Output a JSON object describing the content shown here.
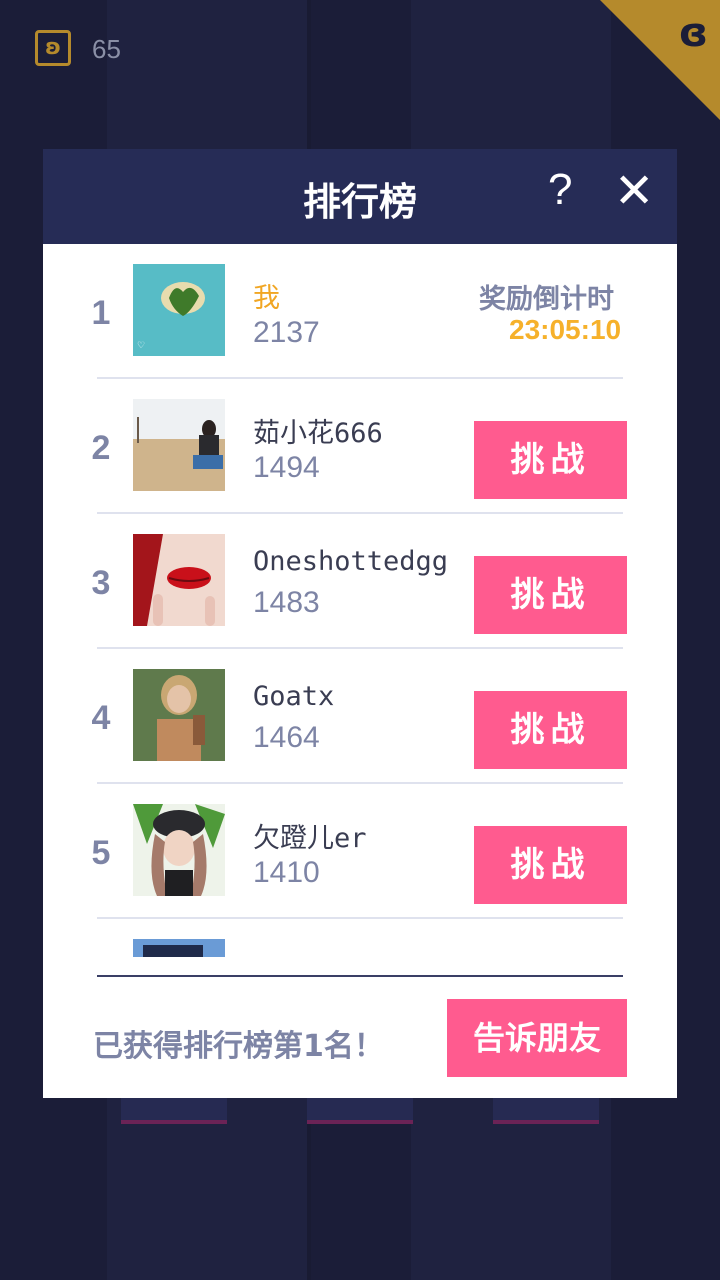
{
  "topbar": {
    "coin_icon": "dragon-coin-icon",
    "coin_count": "65",
    "corner_icon": "dragon-icon"
  },
  "modal": {
    "title": "排行榜",
    "help_label": "?",
    "close_label": "✕",
    "countdown": {
      "label": "奖励倒计时",
      "value": "23:05:10"
    },
    "rows": [
      {
        "rank": "1",
        "name": "我",
        "score": "2137",
        "avatar": "island-photo"
      },
      {
        "rank": "2",
        "name": "茹小花666",
        "score": "1494",
        "avatar": "field-photo",
        "action": "挑战"
      },
      {
        "rank": "3",
        "name": "Oneshottedgg",
        "score": "1483",
        "avatar": "red-lips-photo",
        "action": "挑战"
      },
      {
        "rank": "4",
        "name": "Goatx",
        "score": "1464",
        "avatar": "woman-portrait-photo",
        "action": "挑战"
      },
      {
        "rank": "5",
        "name": "欠蹬儿er",
        "score": "1410",
        "avatar": "girl-leaf-photo",
        "action": "挑战"
      }
    ],
    "footer_text": "已获得排行榜第1名！",
    "share_label": "告诉朋友"
  },
  "colors": {
    "accent": "#ff5b8f",
    "header": "#262c56",
    "gold": "#b58a2c",
    "highlight": "#f6b12b"
  }
}
